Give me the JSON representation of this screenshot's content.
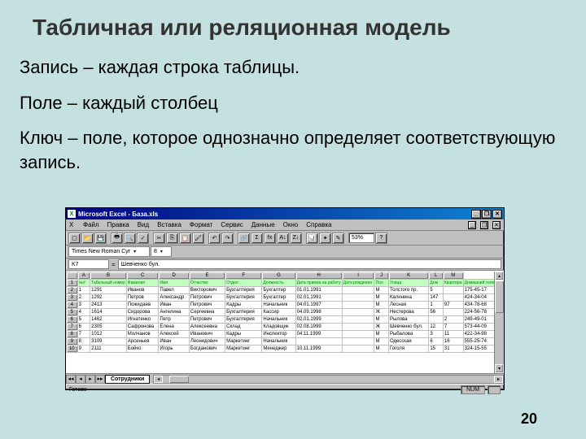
{
  "slide": {
    "title": "Табличная или реляционная модель",
    "p1": "Запись – каждая строка таблицы.",
    "p2": "Поле – каждый столбец",
    "p3": "Ключ – поле, которое однозначно определяет соответствующую запись.",
    "page_number": "20"
  },
  "excel": {
    "title": "Microsoft Excel - База.xls",
    "menu": [
      "Файл",
      "Правка",
      "Вид",
      "Вставка",
      "Формат",
      "Сервис",
      "Данные",
      "Окно",
      "Справка"
    ],
    "zoom": "53%",
    "font_name": "Times New Roman Cyr",
    "font_size": "8",
    "cell_ref": "K7",
    "formula_value": "Шевченко бул.",
    "col_letters": [
      "",
      "A",
      "B",
      "C",
      "D",
      "E",
      "F",
      "G",
      "H",
      "I",
      "J",
      "K",
      "L",
      "M"
    ],
    "field_headers": [
      "№#",
      "Табельный номер",
      "Фамилия",
      "Имя",
      "Отчество",
      "Отдел",
      "Должность",
      "Дата приема на работу",
      "Дата рождения",
      "Пол",
      "Улица",
      "Дом",
      "Квартира",
      "Домашний телефон"
    ],
    "rows": [
      [
        "2",
        "1",
        "1291",
        "Иванов",
        "Павел",
        "Викторович",
        "Бухгалтерия",
        "Бухгалтер",
        "01.01.1991",
        "",
        "М",
        "Толстого пр.",
        "5",
        "",
        "175-45-17"
      ],
      [
        "3",
        "2",
        "1292",
        "Петров",
        "Александр",
        "Петрович",
        "Бухгалтерия",
        "Бухгалтер",
        "02.01.1991",
        "",
        "М",
        "Калинина",
        "147",
        "",
        "424-34-04"
      ],
      [
        "4",
        "3",
        "2413",
        "Пожидаев",
        "Иван",
        "Петрович",
        "Кадры",
        "Начальник",
        "04.01.1997",
        "",
        "М",
        "Лесная",
        "1",
        "97",
        "434-78-68"
      ],
      [
        "5",
        "4",
        "1614",
        "Сидорова",
        "Ангелина",
        "Сергеевна",
        "Бухгалтерия",
        "Кассир",
        "04.09.1998",
        "",
        "Ж",
        "Нестерова",
        "56",
        "",
        "224-56-78"
      ],
      [
        "6",
        "5",
        "1462",
        "Игнатенко",
        "Петр",
        "Петрович",
        "Бухгалтерия",
        "Начальник",
        "02.01.1999",
        "",
        "М",
        "Рылова",
        "",
        "2",
        "249-49-01"
      ],
      [
        "7",
        "6",
        "2305",
        "Сафронова",
        "Елена",
        "Алексеевна",
        "Склад",
        "Кладовщик",
        "02.08.1999",
        "",
        "Ж",
        "Шевченко бул.",
        "12",
        "7",
        "573-44-09"
      ],
      [
        "8",
        "7",
        "1012",
        "Молчанов",
        "Алексей",
        "Иванович",
        "Кадры",
        "Инспектор",
        "04.11.1999",
        "",
        "М",
        "Рыбалова",
        "3",
        "11",
        "422-34-98"
      ],
      [
        "9",
        "8",
        "3109",
        "Арсеньев",
        "Иван",
        "Леонидович",
        "Маркетинг",
        "Начальник",
        "",
        "",
        "М",
        "Одесская",
        "6",
        "16",
        "555-25-74"
      ],
      [
        "10",
        "9",
        "2111",
        "Бойко",
        "Игорь",
        "Богданович",
        "Маркетинг",
        "Менеджер",
        "10.11.1999",
        "",
        "М",
        "Гоголя",
        "15",
        "31",
        "324-15-55"
      ]
    ],
    "sheet_tab": "Сотрудники",
    "status_left": "Готово",
    "status_num": "NUM"
  }
}
